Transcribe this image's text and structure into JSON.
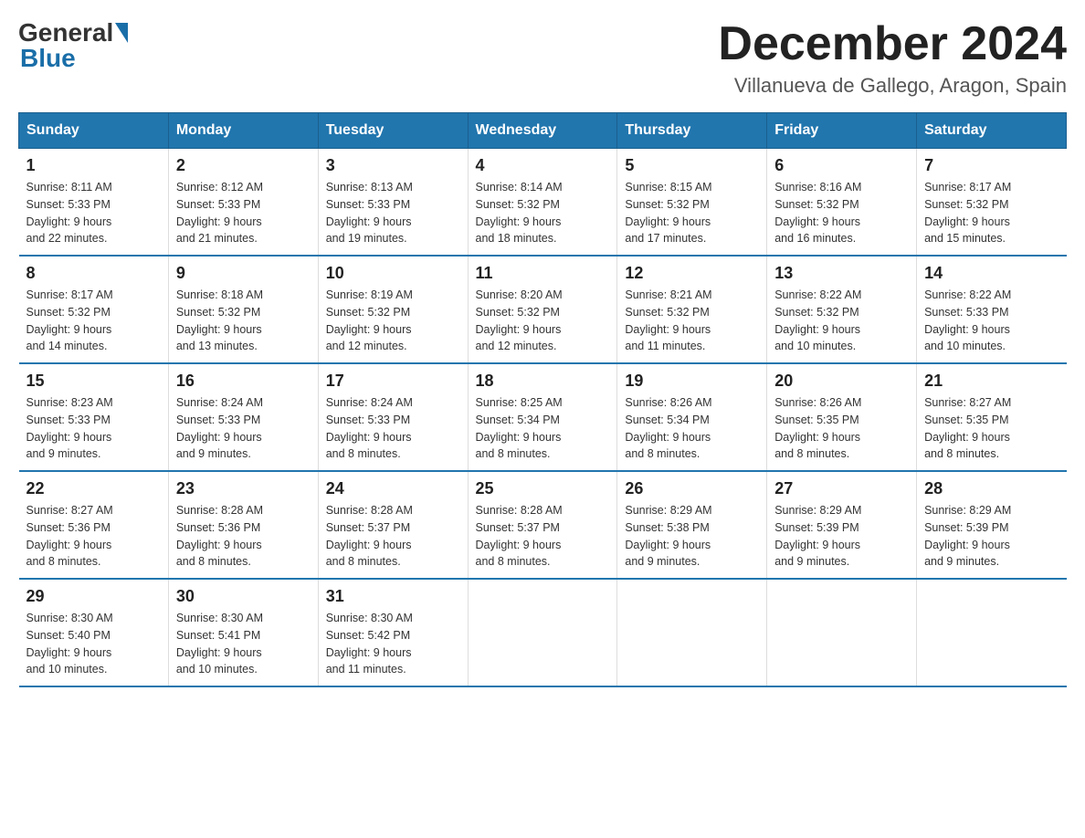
{
  "header": {
    "logo": {
      "general": "General",
      "blue": "Blue"
    },
    "title": "December 2024",
    "location": "Villanueva de Gallego, Aragon, Spain"
  },
  "weekdays": [
    "Sunday",
    "Monday",
    "Tuesday",
    "Wednesday",
    "Thursday",
    "Friday",
    "Saturday"
  ],
  "weeks": [
    [
      {
        "day": "1",
        "sunrise": "8:11 AM",
        "sunset": "5:33 PM",
        "daylight": "9 hours and 22 minutes."
      },
      {
        "day": "2",
        "sunrise": "8:12 AM",
        "sunset": "5:33 PM",
        "daylight": "9 hours and 21 minutes."
      },
      {
        "day": "3",
        "sunrise": "8:13 AM",
        "sunset": "5:33 PM",
        "daylight": "9 hours and 19 minutes."
      },
      {
        "day": "4",
        "sunrise": "8:14 AM",
        "sunset": "5:32 PM",
        "daylight": "9 hours and 18 minutes."
      },
      {
        "day": "5",
        "sunrise": "8:15 AM",
        "sunset": "5:32 PM",
        "daylight": "9 hours and 17 minutes."
      },
      {
        "day": "6",
        "sunrise": "8:16 AM",
        "sunset": "5:32 PM",
        "daylight": "9 hours and 16 minutes."
      },
      {
        "day": "7",
        "sunrise": "8:17 AM",
        "sunset": "5:32 PM",
        "daylight": "9 hours and 15 minutes."
      }
    ],
    [
      {
        "day": "8",
        "sunrise": "8:17 AM",
        "sunset": "5:32 PM",
        "daylight": "9 hours and 14 minutes."
      },
      {
        "day": "9",
        "sunrise": "8:18 AM",
        "sunset": "5:32 PM",
        "daylight": "9 hours and 13 minutes."
      },
      {
        "day": "10",
        "sunrise": "8:19 AM",
        "sunset": "5:32 PM",
        "daylight": "9 hours and 12 minutes."
      },
      {
        "day": "11",
        "sunrise": "8:20 AM",
        "sunset": "5:32 PM",
        "daylight": "9 hours and 12 minutes."
      },
      {
        "day": "12",
        "sunrise": "8:21 AM",
        "sunset": "5:32 PM",
        "daylight": "9 hours and 11 minutes."
      },
      {
        "day": "13",
        "sunrise": "8:22 AM",
        "sunset": "5:32 PM",
        "daylight": "9 hours and 10 minutes."
      },
      {
        "day": "14",
        "sunrise": "8:22 AM",
        "sunset": "5:33 PM",
        "daylight": "9 hours and 10 minutes."
      }
    ],
    [
      {
        "day": "15",
        "sunrise": "8:23 AM",
        "sunset": "5:33 PM",
        "daylight": "9 hours and 9 minutes."
      },
      {
        "day": "16",
        "sunrise": "8:24 AM",
        "sunset": "5:33 PM",
        "daylight": "9 hours and 9 minutes."
      },
      {
        "day": "17",
        "sunrise": "8:24 AM",
        "sunset": "5:33 PM",
        "daylight": "9 hours and 8 minutes."
      },
      {
        "day": "18",
        "sunrise": "8:25 AM",
        "sunset": "5:34 PM",
        "daylight": "9 hours and 8 minutes."
      },
      {
        "day": "19",
        "sunrise": "8:26 AM",
        "sunset": "5:34 PM",
        "daylight": "9 hours and 8 minutes."
      },
      {
        "day": "20",
        "sunrise": "8:26 AM",
        "sunset": "5:35 PM",
        "daylight": "9 hours and 8 minutes."
      },
      {
        "day": "21",
        "sunrise": "8:27 AM",
        "sunset": "5:35 PM",
        "daylight": "9 hours and 8 minutes."
      }
    ],
    [
      {
        "day": "22",
        "sunrise": "8:27 AM",
        "sunset": "5:36 PM",
        "daylight": "9 hours and 8 minutes."
      },
      {
        "day": "23",
        "sunrise": "8:28 AM",
        "sunset": "5:36 PM",
        "daylight": "9 hours and 8 minutes."
      },
      {
        "day": "24",
        "sunrise": "8:28 AM",
        "sunset": "5:37 PM",
        "daylight": "9 hours and 8 minutes."
      },
      {
        "day": "25",
        "sunrise": "8:28 AM",
        "sunset": "5:37 PM",
        "daylight": "9 hours and 8 minutes."
      },
      {
        "day": "26",
        "sunrise": "8:29 AM",
        "sunset": "5:38 PM",
        "daylight": "9 hours and 9 minutes."
      },
      {
        "day": "27",
        "sunrise": "8:29 AM",
        "sunset": "5:39 PM",
        "daylight": "9 hours and 9 minutes."
      },
      {
        "day": "28",
        "sunrise": "8:29 AM",
        "sunset": "5:39 PM",
        "daylight": "9 hours and 9 minutes."
      }
    ],
    [
      {
        "day": "29",
        "sunrise": "8:30 AM",
        "sunset": "5:40 PM",
        "daylight": "9 hours and 10 minutes."
      },
      {
        "day": "30",
        "sunrise": "8:30 AM",
        "sunset": "5:41 PM",
        "daylight": "9 hours and 10 minutes."
      },
      {
        "day": "31",
        "sunrise": "8:30 AM",
        "sunset": "5:42 PM",
        "daylight": "9 hours and 11 minutes."
      },
      null,
      null,
      null,
      null
    ]
  ],
  "labels": {
    "sunrise": "Sunrise:",
    "sunset": "Sunset:",
    "daylight": "Daylight:"
  }
}
